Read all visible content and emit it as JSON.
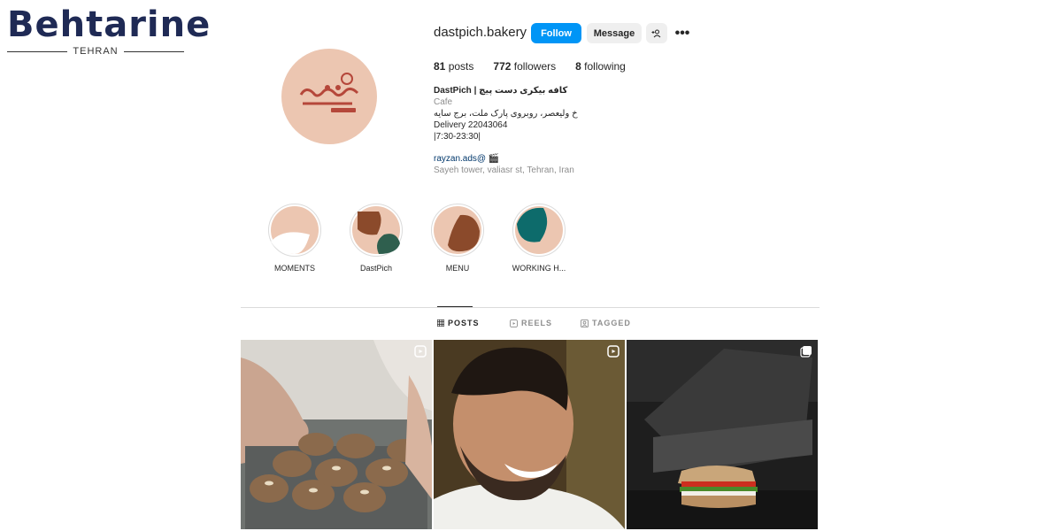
{
  "watermark": {
    "brand": "Behtarine",
    "city": "TEHRAN"
  },
  "profile": {
    "username": "dastpich.bakery",
    "follow_label": "Follow",
    "message_label": "Message",
    "posts_count": "81",
    "posts_label": "posts",
    "followers_count": "772",
    "followers_label": "followers",
    "following_count": "8",
    "following_label": "following",
    "bio_name": "DastPich | کافه بیکری دست پیچ",
    "bio_category": "Cafe",
    "bio_line1": "خ ولیعصر، روبروی پارک ملت، برج سایه",
    "bio_line2": "Delivery 22043064",
    "bio_line3": "|7:30-23:30|",
    "bio_link": "rayzan.ads@ 🎬",
    "bio_address": "Sayeh tower, valiasr st, Tehran, Iran"
  },
  "highlights": [
    {
      "label": "MOMENTS"
    },
    {
      "label": "DastPich"
    },
    {
      "label": "MENU"
    },
    {
      "label": "WORKING H..."
    }
  ],
  "tabs": [
    {
      "label": "POSTS",
      "icon": "grid-icon",
      "active": true
    },
    {
      "label": "REELS",
      "icon": "reels-icon",
      "active": false
    },
    {
      "label": "TAGGED",
      "icon": "tagged-icon",
      "active": false
    }
  ],
  "colors": {
    "accent": "#0095f6",
    "avatar_bg": "#ecc6b1",
    "brown": "#8b4a2b",
    "teal": "#0d6b6b"
  }
}
